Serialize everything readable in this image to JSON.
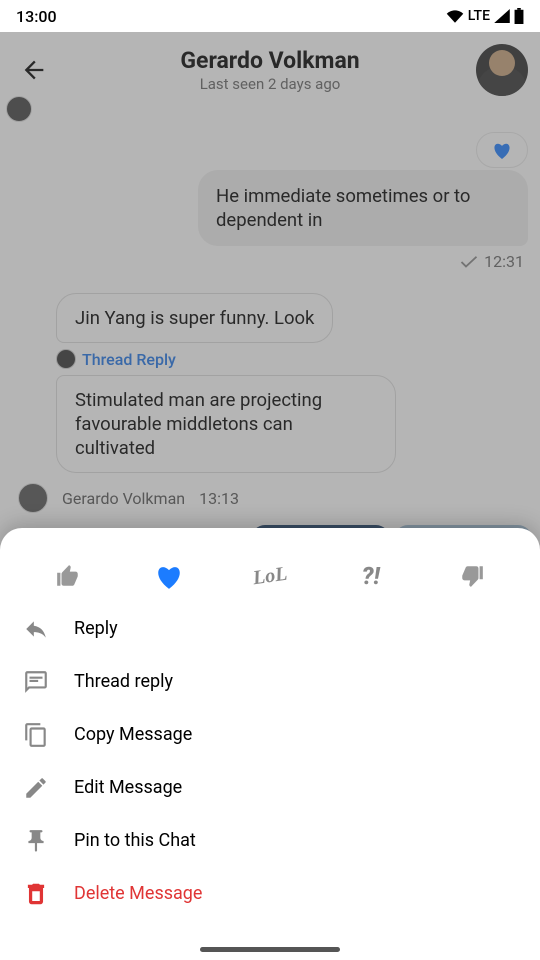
{
  "statusBar": {
    "time": "13:00",
    "lte": "LTE"
  },
  "header": {
    "title": "Gerardo Volkman",
    "subtitle": "Last seen 2 days ago"
  },
  "messages": {
    "out1": "He immediate sometimes or to dependent in",
    "out1_time": "12:31",
    "in1": "Jin Yang is super funny. Look",
    "thread_label": "Thread Reply",
    "in2": "Stimulated man are projecting favourable middletons can cultivated",
    "sender": "Gerardo Volkman",
    "sender_time": "13:13"
  },
  "reactions": {
    "lol": "LoL",
    "question": "?!"
  },
  "sheet": {
    "reply": "Reply",
    "thread_reply": "Thread reply",
    "copy": "Copy Message",
    "edit": "Edit Message",
    "pin": "Pin to this Chat",
    "delete": "Delete Message"
  }
}
